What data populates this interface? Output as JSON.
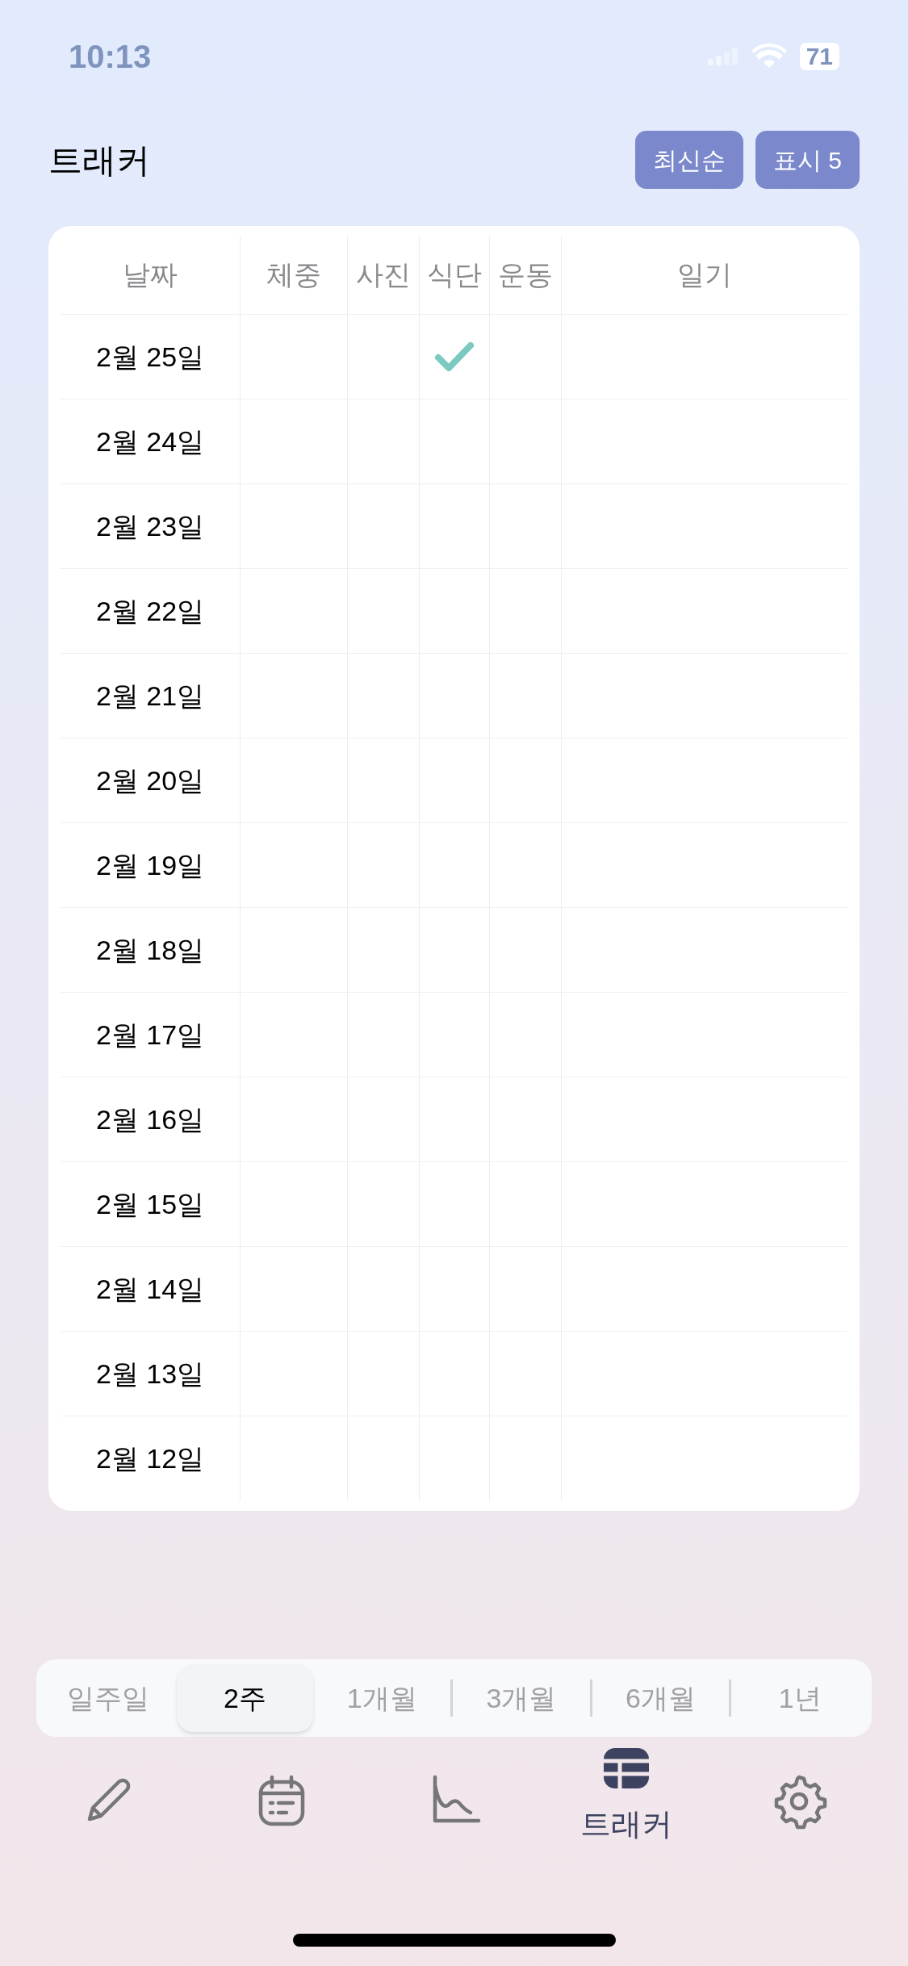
{
  "status_bar": {
    "time": "10:13",
    "battery": "71"
  },
  "header": {
    "title": "트래커",
    "buttons": [
      "최신순",
      "표시 5"
    ]
  },
  "table": {
    "columns": [
      "날짜",
      "체중",
      "사진",
      "식단",
      "운동",
      "일기"
    ],
    "rows": [
      {
        "date": "2월 25일",
        "checked": [
          false,
          false,
          true,
          false,
          false
        ]
      },
      {
        "date": "2월 24일",
        "checked": [
          false,
          false,
          false,
          false,
          false
        ]
      },
      {
        "date": "2월 23일",
        "checked": [
          false,
          false,
          false,
          false,
          false
        ]
      },
      {
        "date": "2월 22일",
        "checked": [
          false,
          false,
          false,
          false,
          false
        ]
      },
      {
        "date": "2월 21일",
        "checked": [
          false,
          false,
          false,
          false,
          false
        ]
      },
      {
        "date": "2월 20일",
        "checked": [
          false,
          false,
          false,
          false,
          false
        ]
      },
      {
        "date": "2월 19일",
        "checked": [
          false,
          false,
          false,
          false,
          false
        ]
      },
      {
        "date": "2월 18일",
        "checked": [
          false,
          false,
          false,
          false,
          false
        ]
      },
      {
        "date": "2월 17일",
        "checked": [
          false,
          false,
          false,
          false,
          false
        ]
      },
      {
        "date": "2월 16일",
        "checked": [
          false,
          false,
          false,
          false,
          false
        ]
      },
      {
        "date": "2월 15일",
        "checked": [
          false,
          false,
          false,
          false,
          false
        ]
      },
      {
        "date": "2월 14일",
        "checked": [
          false,
          false,
          false,
          false,
          false
        ]
      },
      {
        "date": "2월 13일",
        "checked": [
          false,
          false,
          false,
          false,
          false
        ]
      },
      {
        "date": "2월 12일",
        "checked": [
          false,
          false,
          false,
          false,
          false
        ]
      }
    ]
  },
  "range": [
    {
      "label": "일주일",
      "selected": false
    },
    {
      "label": "2주",
      "selected": true
    },
    {
      "label": "1개월",
      "selected": false
    },
    {
      "label": "3개월",
      "selected": false
    },
    {
      "label": "6개월",
      "selected": false
    },
    {
      "label": "1년",
      "selected": false
    }
  ],
  "nav": [
    {
      "kind": "pencil",
      "selected": false
    },
    {
      "kind": "calendar",
      "selected": false
    },
    {
      "kind": "chart",
      "selected": false
    },
    {
      "kind": "table",
      "selected": true,
      "label": "트래커"
    },
    {
      "kind": "gear",
      "selected": false
    }
  ]
}
